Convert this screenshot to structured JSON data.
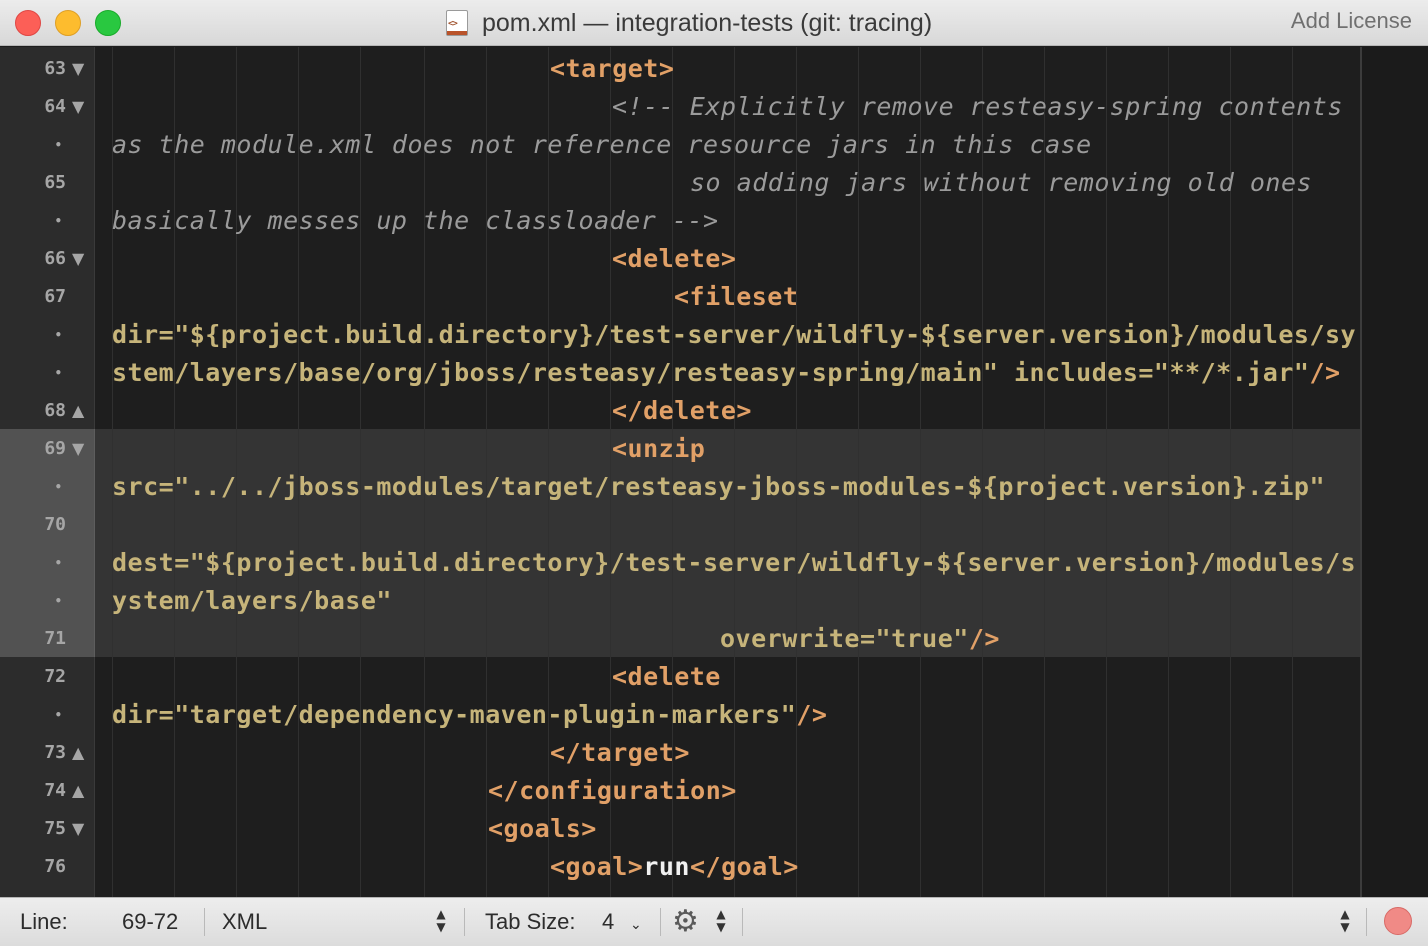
{
  "window": {
    "title": "pom.xml — integration-tests (git: tracing)",
    "file_icon_glyph": "<>",
    "add_license_label": "Add License"
  },
  "colors": {
    "tag": "#e1a067",
    "attribute": "#c6b47a",
    "comment": "#9b9b9b",
    "text": "#f1f1f1",
    "background": "#1e1e1e"
  },
  "lines": [
    {
      "num": "63",
      "fold": "▼",
      "segments": [
        {
          "t": "<target>",
          "k": "tag"
        }
      ]
    },
    {
      "num": "64",
      "fold": "▼",
      "segments": [
        {
          "t": "<!-- Explicitly remove resteasy-spring contents",
          "k": "cmt"
        }
      ]
    },
    {
      "num": "•",
      "fold": "",
      "segments": [
        {
          "t": "as the module.xml does not reference resource jars in this case",
          "k": "cmt"
        }
      ]
    },
    {
      "num": "65",
      "fold": "",
      "segments": [
        {
          "t": "so adding jars without removing old ones",
          "k": "cmt"
        }
      ]
    },
    {
      "num": "•",
      "fold": "",
      "segments": [
        {
          "t": "basically messes up the classloader -->",
          "k": "cmt"
        }
      ]
    },
    {
      "num": "66",
      "fold": "▼",
      "segments": [
        {
          "t": "<delete>",
          "k": "tag"
        }
      ]
    },
    {
      "num": "67",
      "fold": "",
      "segments": [
        {
          "t": "<fileset",
          "k": "tag"
        }
      ]
    },
    {
      "num": "•",
      "fold": "",
      "segments": [
        {
          "t": "dir=\"${project.build.directory}/test-server/wildfly-${server.version}/modules/sy",
          "k": "attr"
        }
      ]
    },
    {
      "num": "•",
      "fold": "",
      "segments": [
        {
          "t": "stem/layers/base/org/jboss/resteasy/resteasy-spring/main\" includes=\"**/*.jar\"",
          "k": "attr"
        },
        {
          "t": "/>",
          "k": "tag"
        }
      ]
    },
    {
      "num": "68",
      "fold": "▲",
      "segments": [
        {
          "t": "</delete>",
          "k": "tag"
        }
      ]
    },
    {
      "num": "69",
      "fold": "▼",
      "segments": [
        {
          "t": "<unzip",
          "k": "tag"
        }
      ]
    },
    {
      "num": "•",
      "fold": "",
      "segments": [
        {
          "t": "src=\"../../jboss-modules/target/resteasy-jboss-modules-${project.version}.zip\"",
          "k": "attr"
        }
      ]
    },
    {
      "num": "70",
      "fold": "",
      "segments": []
    },
    {
      "num": "•",
      "fold": "",
      "segments": [
        {
          "t": "dest=\"${project.build.directory}/test-server/wildfly-${server.version}/modules/s",
          "k": "attr"
        }
      ]
    },
    {
      "num": "•",
      "fold": "",
      "segments": [
        {
          "t": "ystem/layers/base\"",
          "k": "attr"
        }
      ]
    },
    {
      "num": "71",
      "fold": "",
      "segments": [
        {
          "t": "overwrite=\"true\"",
          "k": "attr"
        },
        {
          "t": "/>",
          "k": "tag"
        }
      ]
    },
    {
      "num": "72",
      "fold": "",
      "segments": [
        {
          "t": "<delete",
          "k": "tag"
        }
      ]
    },
    {
      "num": "•",
      "fold": "",
      "segments": [
        {
          "t": "dir=\"target/dependency-maven-plugin-markers\"",
          "k": "attr"
        },
        {
          "t": "/>",
          "k": "tag"
        }
      ]
    },
    {
      "num": "73",
      "fold": "▲",
      "segments": [
        {
          "t": "</target>",
          "k": "tag"
        }
      ]
    },
    {
      "num": "74",
      "fold": "▲",
      "segments": [
        {
          "t": "</configuration>",
          "k": "tag"
        }
      ]
    },
    {
      "num": "75",
      "fold": "▼",
      "segments": [
        {
          "t": "<goals>",
          "k": "tag"
        }
      ]
    },
    {
      "num": "76",
      "fold": "",
      "segments": [
        {
          "t": "<goal>",
          "k": "tag"
        },
        {
          "t": "run",
          "k": "txt"
        },
        {
          "t": "</goal>",
          "k": "tag"
        }
      ]
    }
  ],
  "status": {
    "line_label": "Line:",
    "line_value": "69-72",
    "language": "XML",
    "tab_size_label": "Tab Size:",
    "tab_size_value": "4",
    "settings_icon": "gear-icon",
    "record_icon": "record-button"
  }
}
